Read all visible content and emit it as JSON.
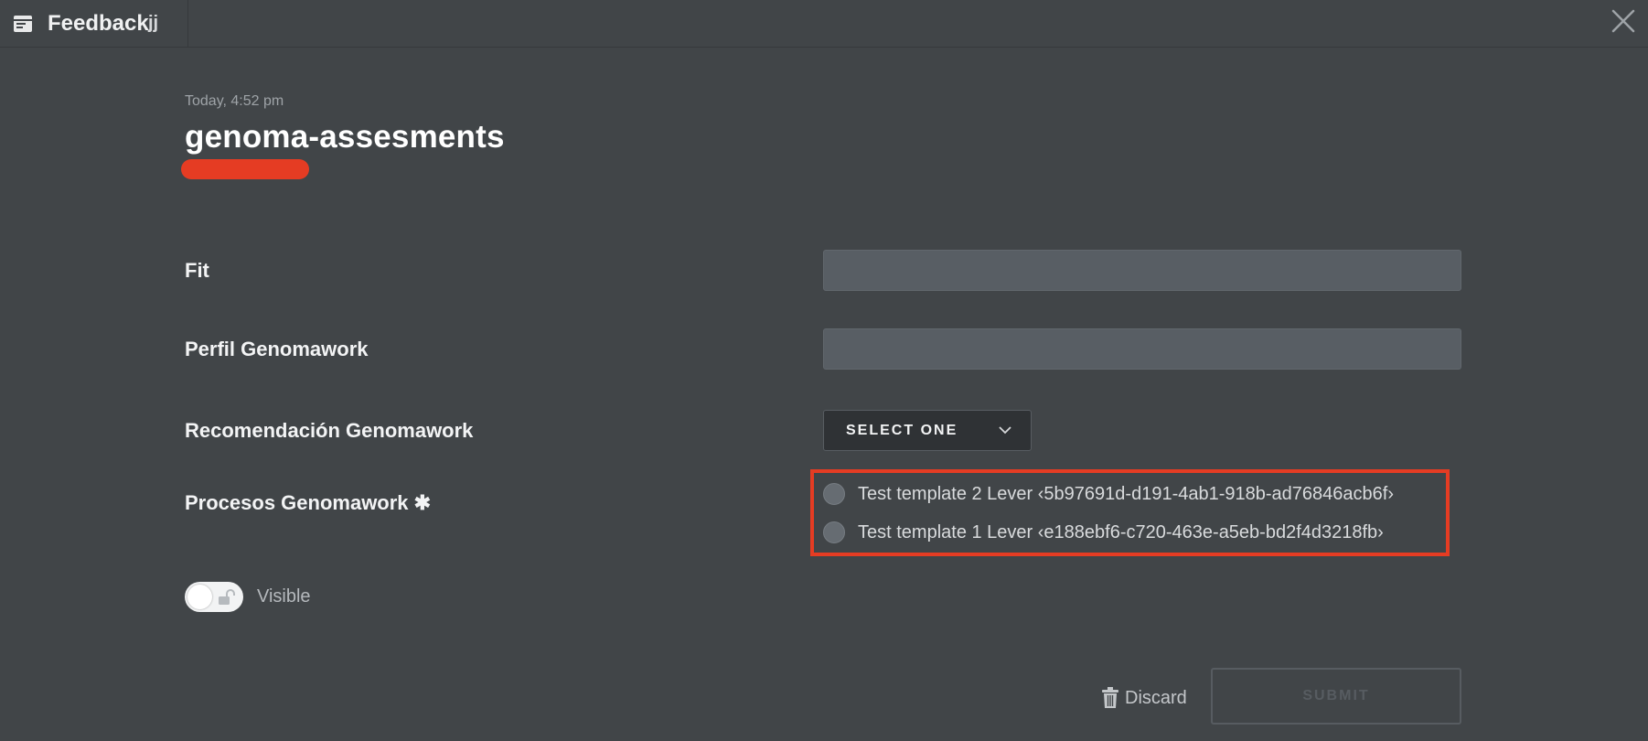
{
  "tab": {
    "icon": "feedback-card-icon",
    "title": "Feedback",
    "subtitle": "jj",
    "close_icon": "close-icon"
  },
  "header": {
    "timestamp": "Today, 4:52 pm",
    "title": "genoma-assesments"
  },
  "form": {
    "fit": {
      "label": "Fit",
      "value": ""
    },
    "perfil": {
      "label": "Perfil Genomawork",
      "value": ""
    },
    "recomendacion": {
      "label": "Recomendación Genomawork",
      "select_label": "SELECT ONE"
    },
    "procesos": {
      "label": "Procesos Genomawork ✱",
      "options": [
        "Test template 2 Lever ‹5b97691d-d191-4ab1-918b-ad76846acb6f›",
        "Test template 1 Lever ‹e188ebf6-c720-463e-a5eb-bd2f4d3218fb›"
      ]
    },
    "visibility": {
      "label": "Visible",
      "state": "on"
    }
  },
  "actions": {
    "discard_label": "Discard",
    "submit_label": "SUBMIT"
  },
  "colors": {
    "background": "#414548",
    "input": "#585e64",
    "highlight": "#e53c23",
    "select_bg": "#2f3235"
  }
}
